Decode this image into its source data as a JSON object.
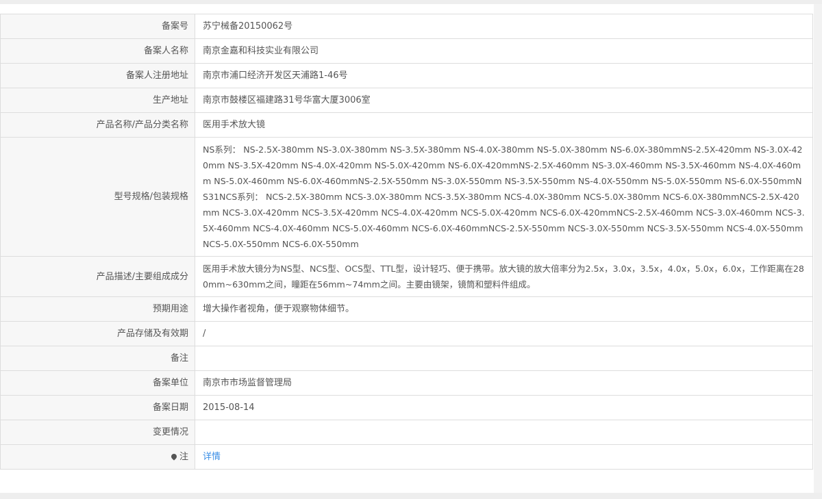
{
  "rows": [
    {
      "label": "备案号",
      "value": "苏宁械备20150062号"
    },
    {
      "label": "备案人名称",
      "value": "南京金嘉和科技实业有限公司"
    },
    {
      "label": "备案人注册地址",
      "value": "南京市浦口经济开发区天浦路1-46号"
    },
    {
      "label": "生产地址",
      "value": "南京市鼓楼区福建路31号华富大厦3006室"
    },
    {
      "label": "产品名称/产品分类名称",
      "value": "医用手术放大镜"
    },
    {
      "label": "型号规格/包装规格",
      "value": "NS系列： NS-2.5X-380mm NS-3.0X-380mm NS-3.5X-380mm NS-4.0X-380mm NS-5.0X-380mm NS-6.0X-380mmNS-2.5X-420mm NS-3.0X-420mm NS-3.5X-420mm NS-4.0X-420mm NS-5.0X-420mm NS-6.0X-420mmNS-2.5X-460mm NS-3.0X-460mm NS-3.5X-460mm NS-4.0X-460mm NS-5.0X-460mm NS-6.0X-460mmNS-2.5X-550mm NS-3.0X-550mm NS-3.5X-550mm NS-4.0X-550mm NS-5.0X-550mm NS-6.0X-550mmNS31NCS系列： NCS-2.5X-380mm NCS-3.0X-380mm NCS-3.5X-380mm NCS-4.0X-380mm NCS-5.0X-380mm NCS-6.0X-380mmNCS-2.5X-420mm NCS-3.0X-420mm NCS-3.5X-420mm NCS-4.0X-420mm NCS-5.0X-420mm NCS-6.0X-420mmNCS-2.5X-460mm NCS-3.0X-460mm NCS-3.5X-460mm NCS-4.0X-460mm NCS-5.0X-460mm NCS-6.0X-460mmNCS-2.5X-550mm NCS-3.0X-550mm NCS-3.5X-550mm NCS-4.0X-550mm NCS-5.0X-550mm NCS-6.0X-550mm"
    },
    {
      "label": "产品描述/主要组成成分",
      "value": "医用手术放大镜分为NS型、NCS型、OCS型、TTL型，设计轻巧、便于携带。放大镜的放大倍率分为2.5x，3.0x，3.5x，4.0x，5.0x，6.0x，工作距离在280mm~630mm之间，瞳距在56mm~74mm之间。主要由镜架，镜筒和塑料件组成。"
    },
    {
      "label": "预期用途",
      "value": "增大操作者视角，便于观察物体细节。"
    },
    {
      "label": "产品存储及有效期",
      "value": "/"
    },
    {
      "label": "备注",
      "value": ""
    },
    {
      "label": "备案单位",
      "value": "南京市市场监督管理局"
    },
    {
      "label": "备案日期",
      "value": "2015-08-14"
    },
    {
      "label": "变更情况",
      "value": ""
    },
    {
      "label": "注",
      "value": "详情",
      "icon": "pin-icon"
    }
  ]
}
